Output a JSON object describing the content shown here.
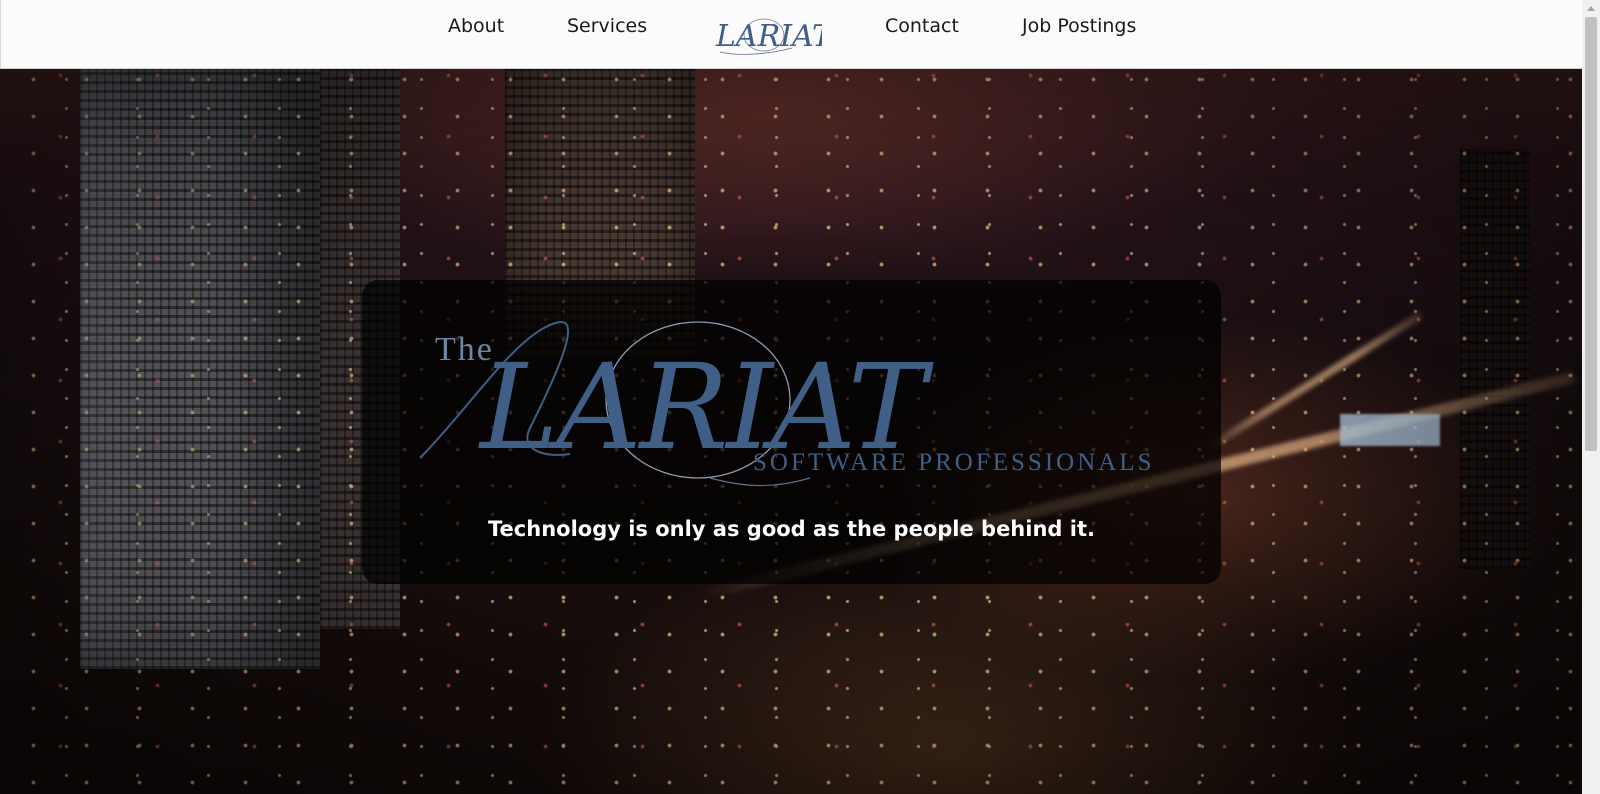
{
  "nav": {
    "about": "About",
    "services": "Services",
    "contact": "Contact",
    "jobs": "Job Postings",
    "logo_alt": "LARIAT"
  },
  "hero": {
    "logo_the": "The",
    "logo_name": "LARIAT",
    "logo_sub": "SOFTWARE PROFESSIONALS",
    "tagline": "Technology is only as good as the people behind it."
  },
  "colors": {
    "nav_bg": "#fbfbfb",
    "logo_blue": "#3f5f86",
    "tagline": "#ffffff"
  },
  "icons": {
    "scroll_up": "chevron-up-icon"
  }
}
